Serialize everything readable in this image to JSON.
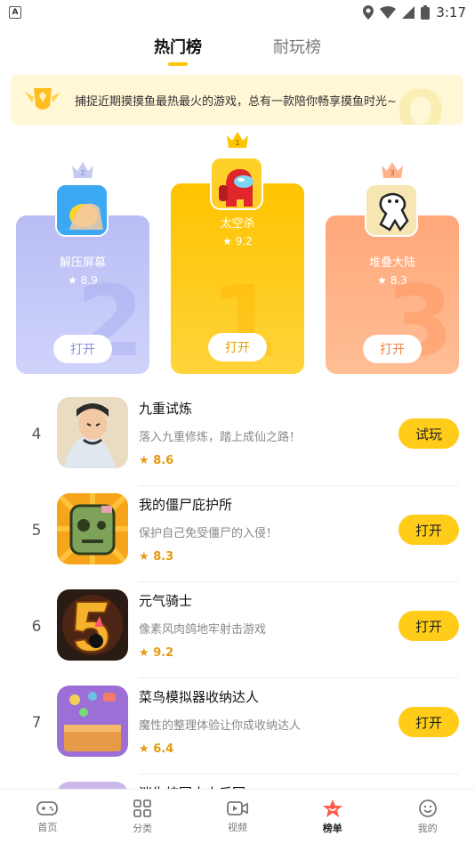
{
  "status": {
    "time": "3:17",
    "left_badge": "A"
  },
  "tabs": [
    {
      "label": "热门榜",
      "active": true
    },
    {
      "label": "耐玩榜",
      "active": false
    }
  ],
  "banner": {
    "text": "捕捉近期摸摸鱼最热最火的游戏，总有一款陪你畅享摸鱼时光~"
  },
  "podium": [
    {
      "rank": "2",
      "name": "解压屏幕",
      "score": "8.9",
      "button": "打开"
    },
    {
      "rank": "1",
      "name": "太空杀",
      "score": "9.2",
      "button": "打开"
    },
    {
      "rank": "3",
      "name": "堆叠大陆",
      "score": "8.3",
      "button": "打开"
    }
  ],
  "list": [
    {
      "rank": "4",
      "title": "九重试炼",
      "desc": "落入九重修炼，踏上成仙之路！",
      "rating": "8.6",
      "button": "试玩"
    },
    {
      "rank": "5",
      "title": "我的僵尸庇护所",
      "desc": "保护自己免受僵尸的入侵！",
      "rating": "8.3",
      "button": "打开"
    },
    {
      "rank": "6",
      "title": "元气骑士",
      "desc": "像素风肉鸽地牢射击游戏",
      "rating": "9.2",
      "button": "打开"
    },
    {
      "rank": "7",
      "title": "菜鸟模拟器收纳达人",
      "desc": "魔性的整理体验让你成收纳达人",
      "rating": "6.4",
      "button": "打开"
    }
  ],
  "next_row_partial": {
    "title": "消失校园大人后回"
  },
  "bottom_nav": [
    {
      "label": "首页",
      "icon": "gamepad-icon",
      "active": false
    },
    {
      "label": "分类",
      "icon": "grid-icon",
      "active": false
    },
    {
      "label": "视频",
      "icon": "video-icon",
      "active": false
    },
    {
      "label": "榜单",
      "icon": "star-icon",
      "active": true
    },
    {
      "label": "我的",
      "icon": "smile-icon",
      "active": false
    }
  ],
  "colors": {
    "accent": "#ffc400",
    "button": "#ffcc1a",
    "rating": "#e39a10"
  }
}
